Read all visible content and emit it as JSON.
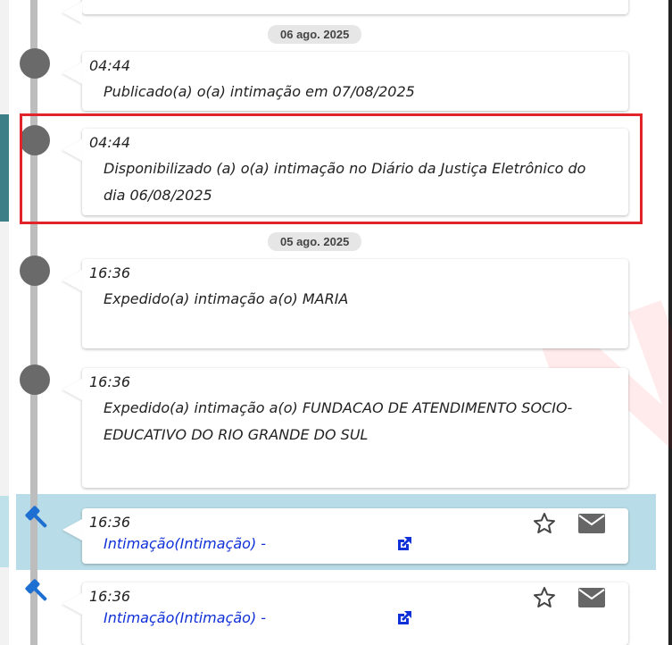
{
  "timeline": {
    "dates": [
      "06 ago. 2025",
      "05 ago. 2025"
    ],
    "events": [
      {
        "time": "04:44",
        "text": "Publicado(a) o(a) intimação em 07/08/2025"
      },
      {
        "time": "04:44",
        "text": "Disponibilizado (a) o(a) intimação no Diário da Justiça Eletrônico do dia 06/08/2025"
      },
      {
        "time": "16:36",
        "text": "Expedido(a) intimação a(o) MARIA"
      },
      {
        "time": "16:36",
        "text": "Expedido(a) intimação a(o) FUNDACAO DE ATENDIMENTO SOCIO-EDUCATIVO DO RIO GRANDE DO SUL"
      },
      {
        "time": "16:36",
        "link": "Intimação(Intimação) -"
      },
      {
        "time": "16:36",
        "link": "Intimação(Intimação) -"
      }
    ]
  },
  "icons": {
    "dot": "timeline-dot",
    "gavel": "gavel-icon",
    "external": "external-link-icon",
    "star": "star-icon",
    "mail": "mail-icon"
  },
  "colors": {
    "highlight_border": "#e0242a",
    "selected_row": "#b9dde8",
    "link": "#1030d8",
    "gavel": "#1d6fd1"
  }
}
